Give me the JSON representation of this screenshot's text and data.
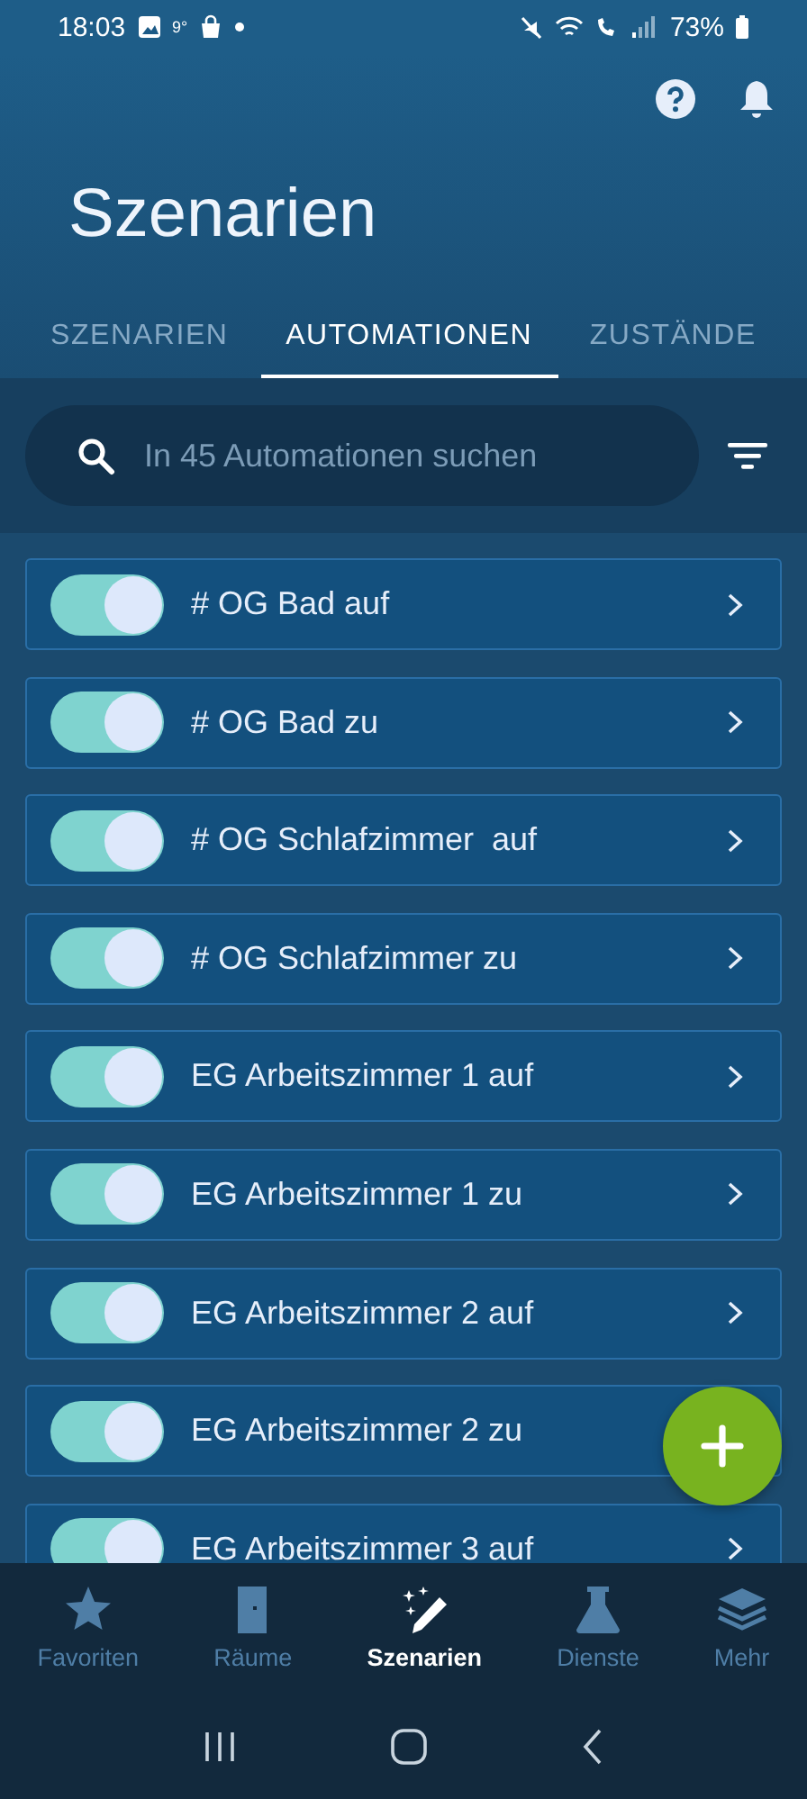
{
  "status_bar": {
    "time": "18:03",
    "temperature": "9°",
    "battery": "73%"
  },
  "header": {
    "title": "Szenarien"
  },
  "tabs": [
    {
      "label": "SZENARIEN",
      "selected": false
    },
    {
      "label": "AUTOMATIONEN",
      "selected": true
    },
    {
      "label": "ZUSTÄNDE",
      "selected": false
    }
  ],
  "search": {
    "placeholder": "In 45 Automationen suchen"
  },
  "automations": [
    {
      "name": "# OG Bad auf",
      "on": true,
      "chevron": true
    },
    {
      "name": "# OG Bad zu",
      "on": true,
      "chevron": true
    },
    {
      "name": "# OG Schlafzimmer  auf",
      "on": true,
      "chevron": true
    },
    {
      "name": "# OG Schlafzimmer zu",
      "on": true,
      "chevron": true
    },
    {
      "name": "EG Arbeitszimmer 1 auf",
      "on": true,
      "chevron": true
    },
    {
      "name": "EG Arbeitszimmer 1 zu",
      "on": true,
      "chevron": true
    },
    {
      "name": "EG Arbeitszimmer 2 auf",
      "on": true,
      "chevron": true
    },
    {
      "name": "EG Arbeitszimmer 2 zu",
      "on": true,
      "chevron": false
    },
    {
      "name": "EG Arbeitszimmer 3 auf",
      "on": true,
      "chevron": true
    }
  ],
  "bottom_nav": [
    {
      "label": "Favoriten",
      "selected": false
    },
    {
      "label": "Räume",
      "selected": false
    },
    {
      "label": "Szenarien",
      "selected": true
    },
    {
      "label": "Dienste",
      "selected": false
    },
    {
      "label": "Mehr",
      "selected": false
    }
  ]
}
